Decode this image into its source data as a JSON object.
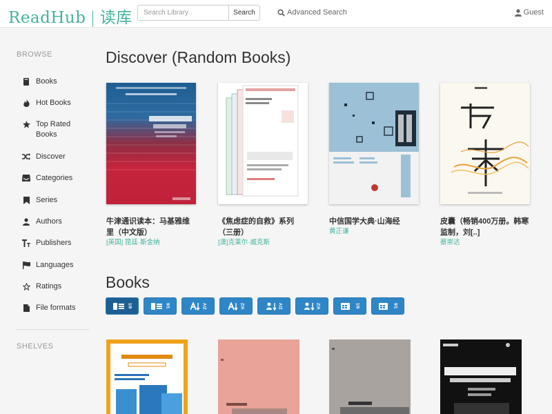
{
  "header": {
    "brand_latin": "ReadHub",
    "brand_sep": "|",
    "brand_cjk": "读库",
    "search_placeholder": "Search Library",
    "search_button": "Search",
    "advanced_search": "Advanced Search",
    "user": "Guest"
  },
  "sidebar": {
    "browse_heading": "BROWSE",
    "items": [
      {
        "label": "Books",
        "icon": "book-icon"
      },
      {
        "label": "Hot Books",
        "icon": "fire-icon"
      },
      {
        "label": "Top Rated Books",
        "icon": "star-icon"
      },
      {
        "label": "Discover",
        "icon": "random-icon"
      },
      {
        "label": "Categories",
        "icon": "inbox-icon"
      },
      {
        "label": "Series",
        "icon": "bookmark-icon"
      },
      {
        "label": "Authors",
        "icon": "user-icon"
      },
      {
        "label": "Publishers",
        "icon": "text-size-icon"
      },
      {
        "label": "Languages",
        "icon": "flag-icon"
      },
      {
        "label": "Ratings",
        "icon": "star-outline-icon"
      },
      {
        "label": "File formats",
        "icon": "file-icon"
      }
    ],
    "shelves_heading": "SHELVES"
  },
  "discover": {
    "title": "Discover (Random Books)",
    "books": [
      {
        "title": "牛津通识读本：马基雅维里（中文版）",
        "author": "[英国] 昆廷·斯金纳"
      },
      {
        "title": "《焦虑症的自救》系列（三册）",
        "author": "[澳]克莱尔·威克斯"
      },
      {
        "title": "中信国学大典·山海经",
        "author": "黄正谦"
      },
      {
        "title": "皮囊（畅销400万册。韩寒监制，刘[..]",
        "author": "蔡崇达"
      }
    ]
  },
  "books_section": {
    "title": "Books",
    "sort_buttons": [
      {
        "name": "sort-date-new-button",
        "active": true,
        "sub": "1/9"
      },
      {
        "name": "sort-date-old-button",
        "active": false,
        "sub": "9/1"
      },
      {
        "name": "sort-title-az-button",
        "active": false,
        "sub": "A/Z"
      },
      {
        "name": "sort-title-za-button",
        "active": false,
        "sub": "Z/A"
      },
      {
        "name": "sort-author-az-button",
        "active": false,
        "sub": "A/Z"
      },
      {
        "name": "sort-author-za-button",
        "active": false,
        "sub": "Z/A"
      },
      {
        "name": "sort-pubdate-new-button",
        "active": false,
        "sub": "1/9"
      },
      {
        "name": "sort-pubdate-old-button",
        "active": false,
        "sub": "9/1"
      }
    ]
  },
  "colors": {
    "accent": "#45b29d",
    "button": "#2f86c6",
    "button_active": "#1e5f93"
  }
}
